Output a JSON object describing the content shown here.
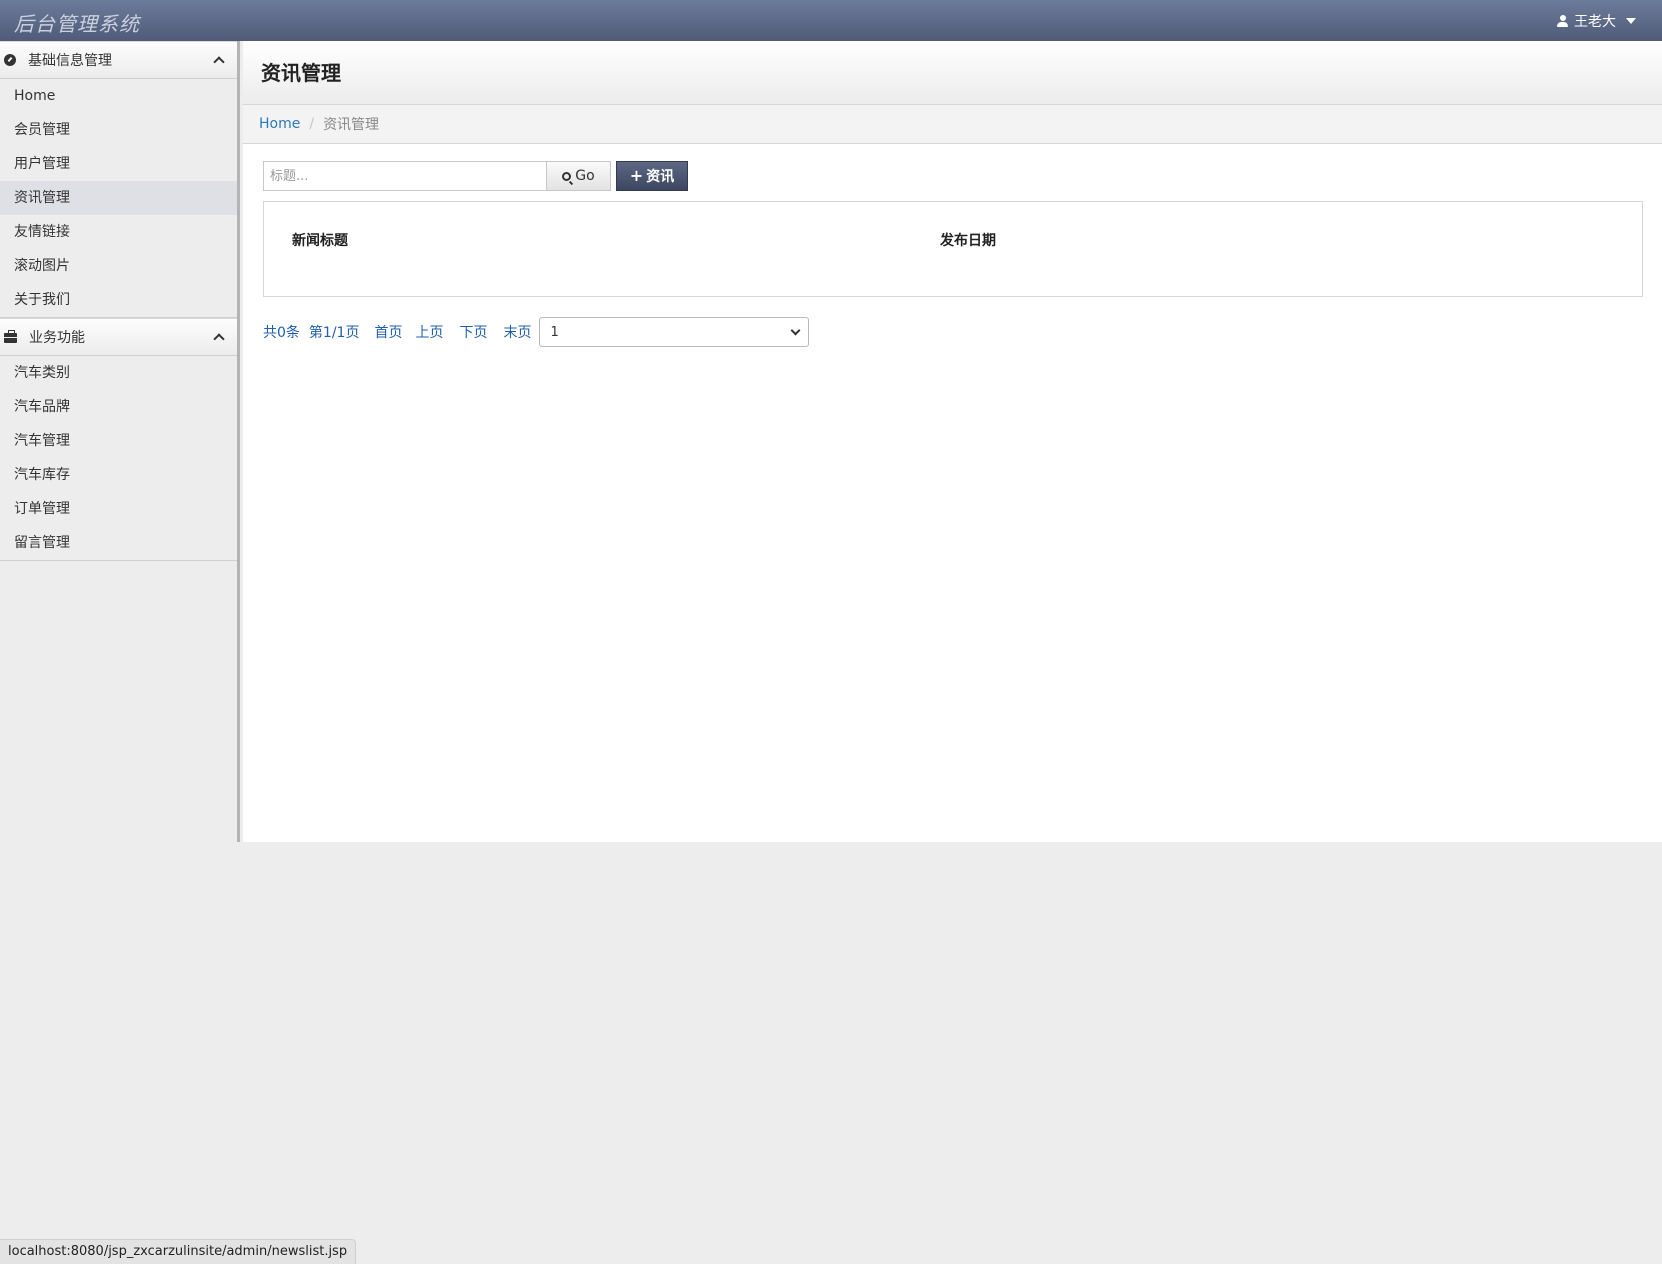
{
  "app": {
    "brand": "后台管理系统",
    "user_name": "王老大"
  },
  "sidebar": {
    "sections": [
      {
        "header": "基础信息管理",
        "items": [
          "Home",
          "会员管理",
          "用户管理",
          "资讯管理",
          "友情链接",
          "滚动图片",
          "关于我们"
        ]
      },
      {
        "header": "业务功能",
        "items": [
          "汽车类别",
          "汽车品牌",
          "汽车管理",
          "汽车库存",
          "订单管理",
          "留言管理"
        ]
      }
    ],
    "active_item": "资讯管理"
  },
  "page": {
    "title": "资讯管理",
    "breadcrumb": {
      "home": "Home",
      "current": "资讯管理"
    }
  },
  "toolbar": {
    "search_placeholder": "标题...",
    "go_label": "Go",
    "add_label": "资讯"
  },
  "table": {
    "columns": [
      "新闻标题",
      "发布日期"
    ],
    "rows": []
  },
  "pager": {
    "total": "共0条",
    "page_info": "第1/1页",
    "first": "首页",
    "prev": "上页",
    "next": "下页",
    "last": "末页",
    "selected_page": "1"
  },
  "status_url": "localhost:8080/jsp_zxcarzulinsite/admin/newslist.jsp"
}
